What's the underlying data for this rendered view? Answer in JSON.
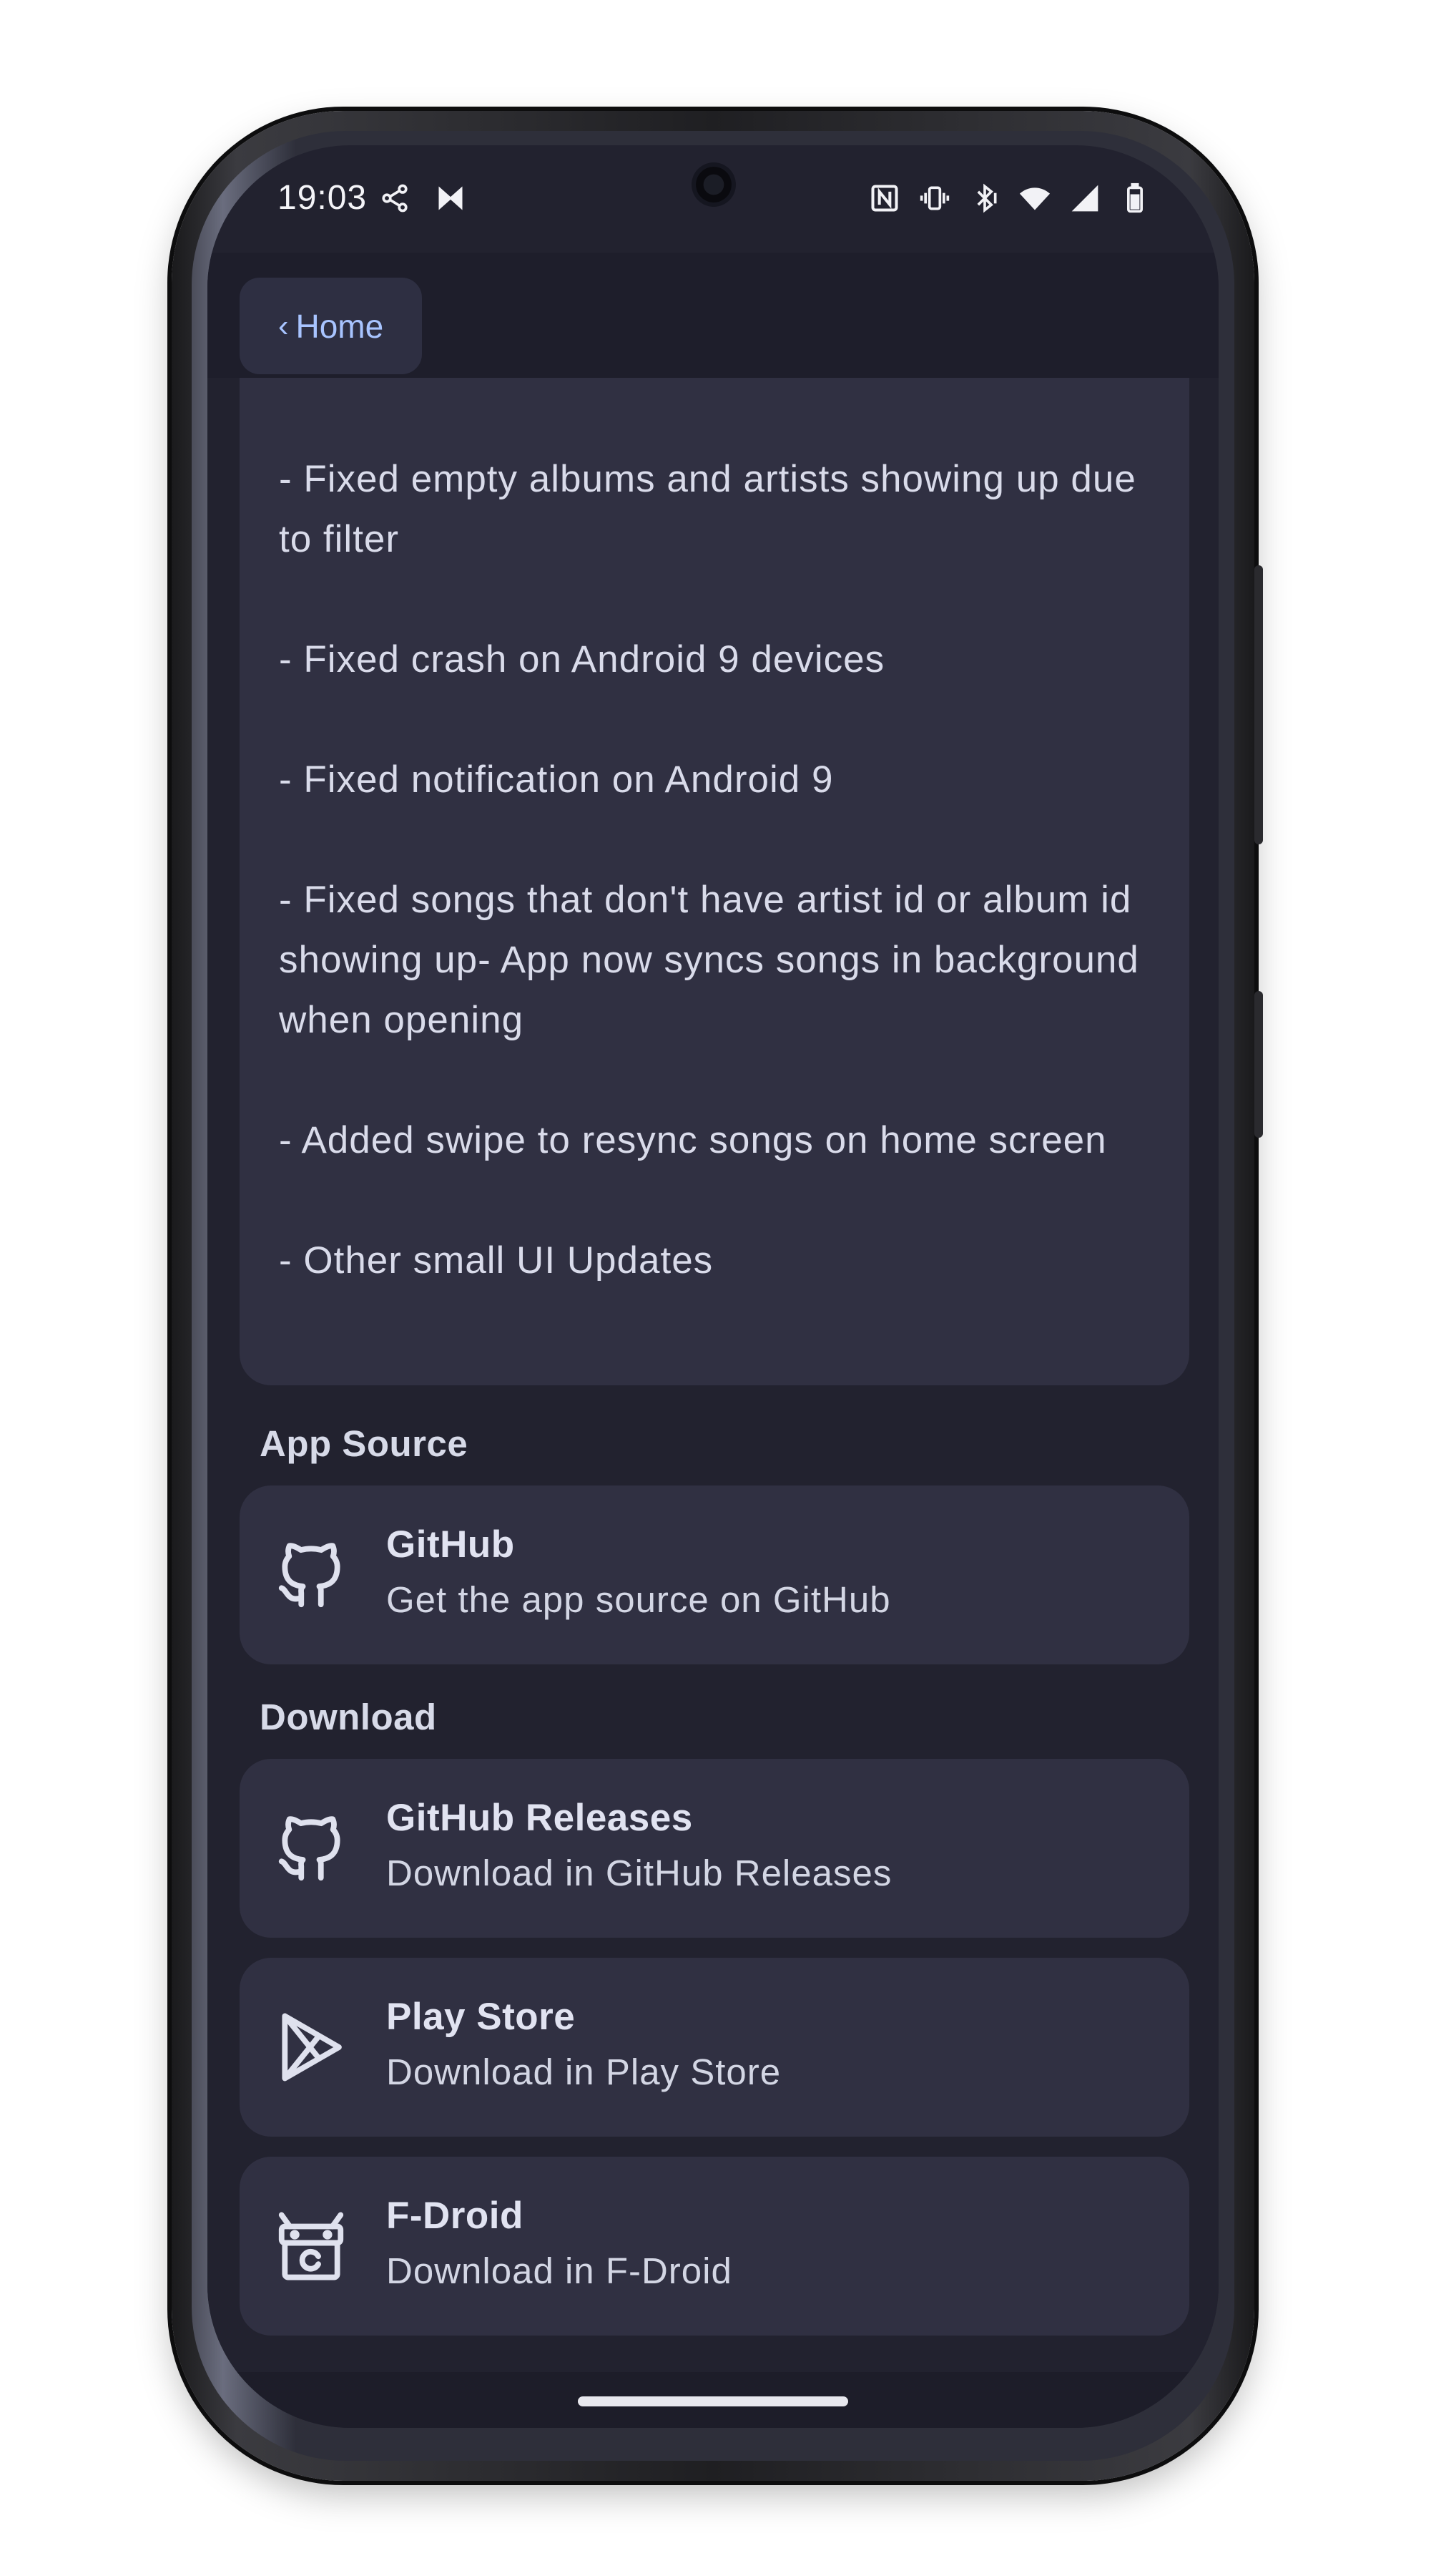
{
  "status_bar": {
    "time": "19:03"
  },
  "header": {
    "back_label": "Home",
    "back_chevron": "‹"
  },
  "changelog": {
    "items": [
      "- Fixed empty albums and artists showing up due to filter",
      "- Fixed crash on Android 9 devices",
      "- Fixed notification on Android 9",
      "- Fixed songs that don't have artist id or album id showing up- App now syncs songs in background when opening",
      "- Added swipe to resync songs on home screen",
      "- Other small UI Updates"
    ]
  },
  "sections": {
    "app_source": {
      "title": "App Source",
      "items": [
        {
          "icon": "github-icon",
          "title": "GitHub",
          "subtitle": "Get the app source on GitHub"
        }
      ]
    },
    "download": {
      "title": "Download",
      "items": [
        {
          "icon": "github-icon",
          "title": "GitHub Releases",
          "subtitle": "Download in GitHub Releases"
        },
        {
          "icon": "play-store-icon",
          "title": "Play Store",
          "subtitle": "Download in Play Store"
        },
        {
          "icon": "f-droid-icon",
          "title": "F-Droid",
          "subtitle": "Download in F-Droid"
        }
      ]
    }
  },
  "colors": {
    "background": "#22222f",
    "card": "#303042",
    "accent": "#a8c4ff",
    "text": "#d9dbea"
  }
}
